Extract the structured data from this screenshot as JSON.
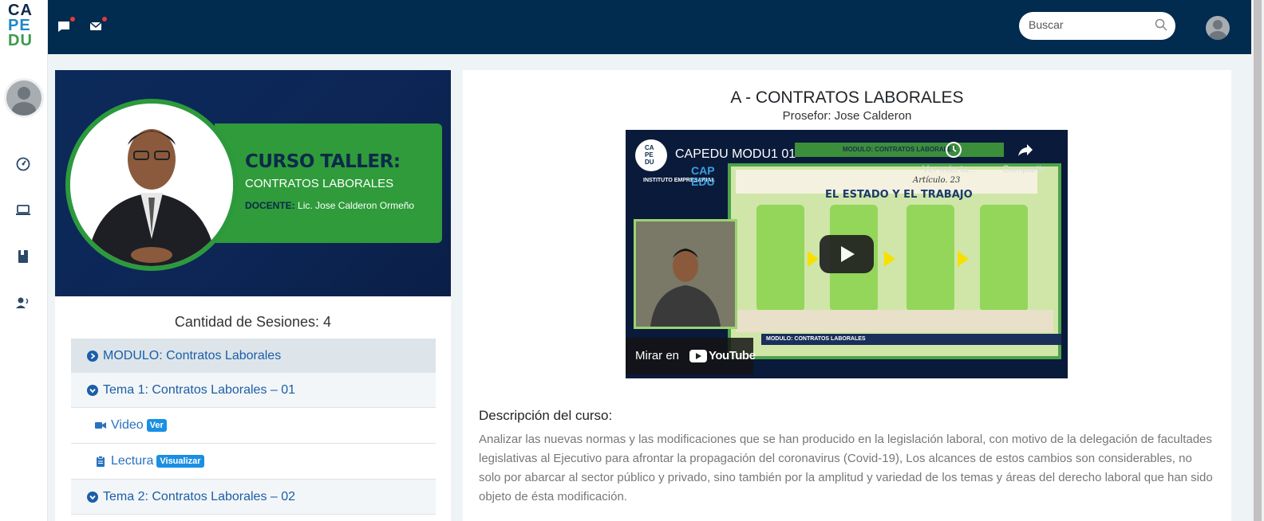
{
  "brand": {
    "logo_line1": "CA",
    "logo_line2": "PE",
    "logo_line3": "DU"
  },
  "topbar": {
    "chat_icon": "chat-icon",
    "mail_icon": "mail-icon",
    "search_placeholder": "Buscar",
    "search_icon": "search-icon"
  },
  "sidebar": {
    "items": [
      {
        "icon": "dashboard-icon"
      },
      {
        "icon": "laptop-icon"
      },
      {
        "icon": "book-icon"
      },
      {
        "icon": "support-icon"
      }
    ]
  },
  "course_banner": {
    "title": "CURSO TALLER:",
    "subtitle": "CONTRATOS LABORALES",
    "teacher_label": "DOCENTE:",
    "teacher_name": "Lic. Jose Calderon Ormeño"
  },
  "sessions_label": "Cantidad de Sesiones: 4",
  "curriculum": {
    "module": "MODULO: Contratos Laborales",
    "tema1": "Tema 1: Contratos Laborales – 01",
    "video_label": "Video",
    "video_badge": "Ver",
    "reading_label": "Lectura",
    "reading_badge": "Visualizar",
    "tema2": "Tema 2: Contratos Laborales – 02"
  },
  "course": {
    "title": "A - CONTRATOS LABORALES",
    "professor": "Prosefor: Jose Calderon"
  },
  "video": {
    "channel_logo": "CAPEDU",
    "title": "CAPEDU MODU1 01",
    "watch_later": "Ver más ta...",
    "share": "Compartir",
    "watch_on": "Mirar en",
    "youtube": "YouTube",
    "slide_banner": "MODULO: CONTRATOS LABORALES",
    "slide_article": "Artículo. 23",
    "slide_title": "EL ESTADO Y EL TRABAJO",
    "slide_footer": "MODULO:   CONTRATOS LABORALES",
    "slide_brand_small": "INSTITUTO EMPRESARIAL",
    "slide_brand_big": "CAPEDU"
  },
  "description": {
    "title": "Descripción del curso:",
    "text": "Analizar las nuevas normas y las modificaciones que se han producido en la legislación laboral, con motivo de la delegación de facultades legislativas al Ejecutivo para afrontar la propagación del coronavirus (Covid-19), Los alcances de estos cambios son considerables, no solo por abarcar al sector público y privado, sino también por la amplitud y variedad de los temas y áreas del derecho laboral que han sido objeto de ésta modificación."
  }
}
